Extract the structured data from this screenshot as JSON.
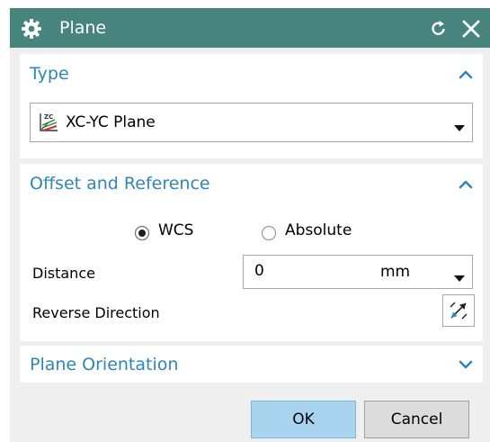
{
  "window": {
    "title": "Plane",
    "icons": {
      "app": "gear-icon",
      "reset": "reset-icon",
      "close": "close-icon"
    }
  },
  "type_section": {
    "header": "Type",
    "collapse_icon": "chevron-up-icon",
    "selected": "XC-YC Plane",
    "selected_icon": "xc-yc-plane-icon"
  },
  "offset_section": {
    "header": "Offset and Reference",
    "collapse_icon": "chevron-up-icon",
    "reference_options": [
      {
        "label": "WCS",
        "selected": true
      },
      {
        "label": "Absolute",
        "selected": false
      }
    ],
    "distance_label": "Distance",
    "distance_value": "0",
    "distance_unit": "mm",
    "reverse_label": "Reverse Direction",
    "reverse_icon": "reverse-direction-icon"
  },
  "orientation_section": {
    "header": "Plane Orientation",
    "expand_icon": "chevron-down-icon"
  },
  "buttons": {
    "ok": "OK",
    "cancel": "Cancel"
  },
  "colors": {
    "titlebar": "#47847e",
    "section_header_text": "#2e86b8",
    "ok_button": "#a9d4ef"
  }
}
